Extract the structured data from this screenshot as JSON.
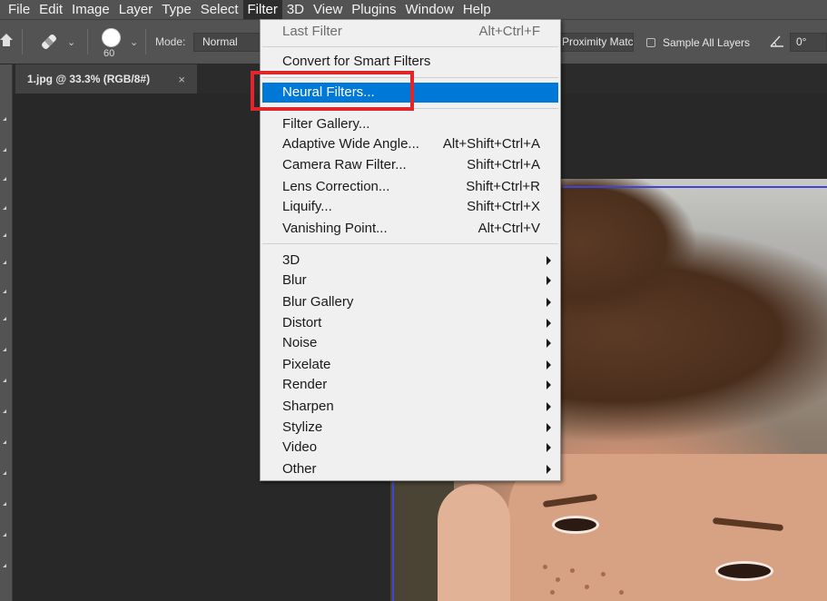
{
  "menubar": {
    "items": [
      "File",
      "Edit",
      "Image",
      "Layer",
      "Type",
      "Select",
      "Filter",
      "3D",
      "View",
      "Plugins",
      "Window",
      "Help"
    ],
    "active": "Filter"
  },
  "options": {
    "brush_size": "60",
    "mode_label": "Mode:",
    "mode_value": "Normal",
    "proximity_button": "Proximity Match",
    "sample_all_layers": "Sample All Layers",
    "angle_value": "0°"
  },
  "document": {
    "tab_title": "1.jpg @ 33.3% (RGB/8#)",
    "close_glyph": "×"
  },
  "filter_menu": {
    "last_filter": {
      "label": "Last Filter",
      "shortcut": "Alt+Ctrl+F"
    },
    "convert_smart": {
      "label": "Convert for Smart Filters"
    },
    "neural_filters": {
      "label": "Neural Filters..."
    },
    "gallery_items": [
      {
        "label": "Filter Gallery...",
        "shortcut": ""
      },
      {
        "label": "Adaptive Wide Angle...",
        "shortcut": "Alt+Shift+Ctrl+A"
      },
      {
        "label": "Camera Raw Filter...",
        "shortcut": "Shift+Ctrl+A"
      },
      {
        "label": "Lens Correction...",
        "shortcut": "Shift+Ctrl+R"
      },
      {
        "label": "Liquify...",
        "shortcut": "Shift+Ctrl+X"
      },
      {
        "label": "Vanishing Point...",
        "shortcut": "Alt+Ctrl+V"
      }
    ],
    "submenus": [
      "3D",
      "Blur",
      "Blur Gallery",
      "Distort",
      "Noise",
      "Pixelate",
      "Render",
      "Sharpen",
      "Stylize",
      "Video",
      "Other"
    ]
  },
  "colors": {
    "highlight": "#0078d7",
    "annotation_box": "#e0262b",
    "guide": "#3e45d6"
  }
}
